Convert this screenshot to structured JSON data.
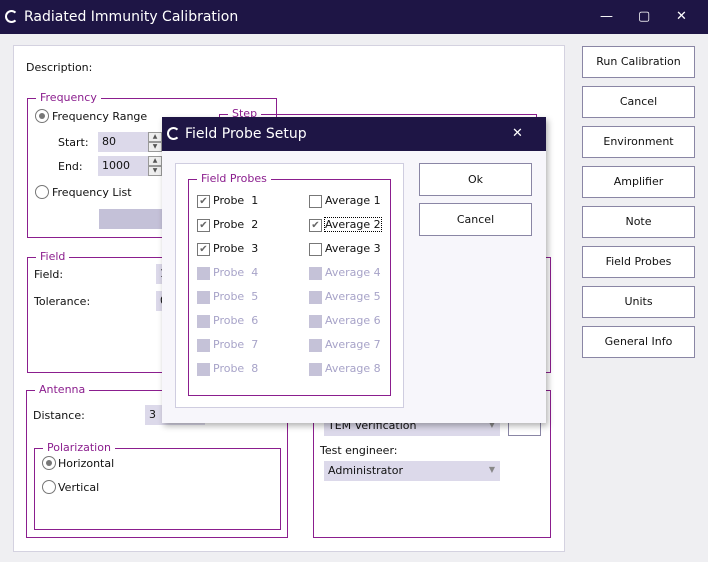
{
  "window": {
    "title": "Radiated Immunity Calibration",
    "minimize": "—",
    "maximize": "▢",
    "close": "✕"
  },
  "main": {
    "description_label": "Description:",
    "frequency": {
      "title": "Frequency",
      "range_label": "Frequency Range",
      "range_selected": true,
      "start_label": "Start:",
      "start_value": "80",
      "end_label": "End:",
      "end_value": "1000",
      "list_label": "Frequency List",
      "list_selected": false
    },
    "step": {
      "title": "Step"
    },
    "field": {
      "title": "Field",
      "field_label": "Field:",
      "field_value": "1",
      "tolerance_label": "Tolerance:",
      "tolerance_value": "0"
    },
    "antenna": {
      "title": "Antenna",
      "distance_label": "Distance:",
      "distance_value": "3",
      "polarization": {
        "title": "Polarization",
        "options": [
          "Horizontal",
          "Vertical"
        ],
        "selected": "Horizontal"
      }
    },
    "right_panel": {
      "combo_value": "TEM Verification",
      "engineer_label": "Test engineer:",
      "engineer_value": "Administrator"
    }
  },
  "side_buttons": [
    "Run Calibration",
    "Cancel",
    "Environment",
    "Amplifier",
    "Note",
    "Field Probes",
    "Units",
    "General Info"
  ],
  "dialog": {
    "title": "Field Probe Setup",
    "close": "✕",
    "group_title": "Field Probes",
    "probes": [
      {
        "label": "Probe  1",
        "checked": true,
        "enabled": true
      },
      {
        "label": "Probe  2",
        "checked": true,
        "enabled": true
      },
      {
        "label": "Probe  3",
        "checked": true,
        "enabled": true
      },
      {
        "label": "Probe  4",
        "checked": false,
        "enabled": false
      },
      {
        "label": "Probe  5",
        "checked": false,
        "enabled": false
      },
      {
        "label": "Probe  6",
        "checked": false,
        "enabled": false
      },
      {
        "label": "Probe  7",
        "checked": false,
        "enabled": false
      },
      {
        "label": "Probe  8",
        "checked": false,
        "enabled": false
      }
    ],
    "averages": [
      {
        "label": "Average 1",
        "checked": false,
        "enabled": true
      },
      {
        "label": "Average 2",
        "checked": true,
        "enabled": true,
        "focused": true
      },
      {
        "label": "Average 3",
        "checked": false,
        "enabled": true
      },
      {
        "label": "Average 4",
        "checked": false,
        "enabled": false
      },
      {
        "label": "Average 5",
        "checked": false,
        "enabled": false
      },
      {
        "label": "Average 6",
        "checked": false,
        "enabled": false
      },
      {
        "label": "Average 7",
        "checked": false,
        "enabled": false
      },
      {
        "label": "Average 8",
        "checked": false,
        "enabled": false
      }
    ],
    "ok": "Ok",
    "cancel": "Cancel"
  }
}
